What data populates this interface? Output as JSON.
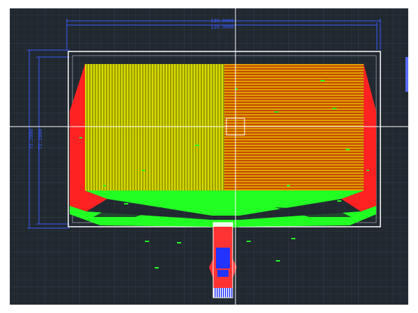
{
  "window": {
    "background": "#ffffff",
    "viewport_bg": "#212830",
    "grid_minor": "#2b333c",
    "grid_major": "#333c47"
  },
  "drawing": {
    "colors": {
      "outline": "#ffffff",
      "dimension": "#3a5cff",
      "yellow_traces": "#b8b400",
      "orange_traces": "#d98a00",
      "red_region": "#ff2222",
      "green_region": "#22ff22",
      "flex_blue": "#2233ff",
      "flex_red": "#ff3333",
      "crosshair": "#ffffff"
    },
    "dimensions": {
      "width_outer": "130.0000",
      "width_inner": "120.0000",
      "height_outer": "75.2000",
      "height_inner": "72.2000"
    }
  }
}
